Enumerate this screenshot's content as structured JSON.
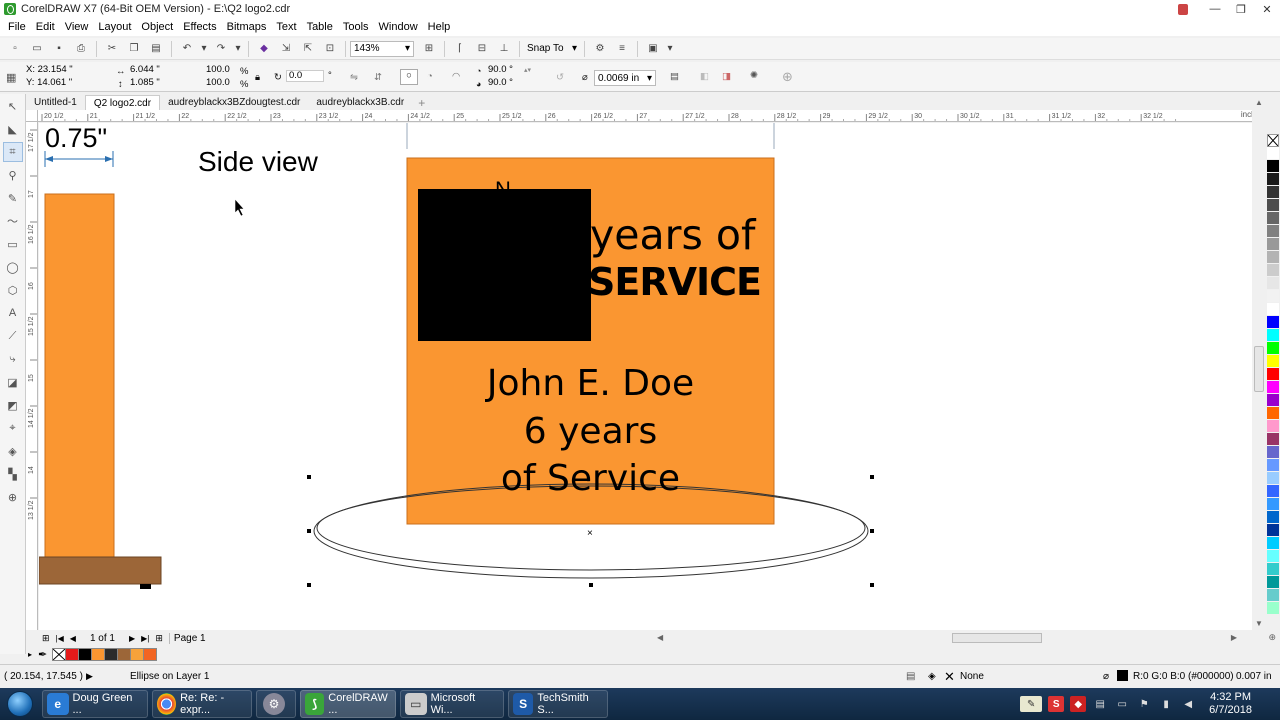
{
  "window": {
    "title": "CorelDRAW X7 (64-Bit OEM Version) - E:\\Q2 logo2.cdr",
    "minimize": "—",
    "maximize": "❐",
    "close": "✕"
  },
  "menu": [
    "File",
    "Edit",
    "View",
    "Layout",
    "Object",
    "Effects",
    "Bitmaps",
    "Text",
    "Table",
    "Tools",
    "Window",
    "Help"
  ],
  "toolbar": {
    "zoom": "143%",
    "snap_to": "Snap To"
  },
  "properties": {
    "x": "X: 23.154 \"",
    "y": "Y: 14.061 \"",
    "width": "6.044 \"",
    "height": "1.085 \"",
    "scale_w": "100.0",
    "scale_h": "100.0",
    "pct": "%",
    "rotation": "0.0",
    "deg": "°",
    "start_angle": "90.0 °",
    "end_angle": "90.0 °",
    "outline_width": "0.0069 in"
  },
  "doc_tabs": [
    "Untitled-1",
    "Q2 logo2.cdr",
    "audreyblackx3BZdougtest.cdr",
    "audreyblackx3B.cdr"
  ],
  "ruler": {
    "h_labels": [
      "20 1/2",
      "21",
      "21 1/2",
      "22",
      "22 1/2",
      "23",
      "23 1/2",
      "24",
      "24 1/2",
      "25",
      "25 1/2",
      "26",
      "26 1/2",
      "27",
      "27 1/2",
      "28",
      "28 1/2",
      "29",
      "29 1/2",
      "30",
      "30 1/2",
      "31",
      "31 1/2",
      "32",
      "32 1/2"
    ],
    "units": "inches",
    "v_labels": [
      "17 1/2",
      "17",
      "16 1/2",
      "16",
      "15 1/2",
      "15",
      "14 1/2",
      "14",
      "13 1/2"
    ]
  },
  "canvas": {
    "dimension_label": "0.75\"",
    "side_view_label": "Side view",
    "plaque": {
      "line1": "years of",
      "line2": "SERVICE",
      "name": "John E. Doe",
      "years": "6 years",
      "service": "of Service"
    }
  },
  "colors": {
    "plaque_orange": "#fa9631",
    "base_brown": "#9c6638",
    "selection_black": "#000000"
  },
  "pagebar": {
    "page_count": "1 of 1",
    "page_tab": "Page 1"
  },
  "status": {
    "coords": "( 20.154, 17.545 )",
    "selection": "Ellipse on Layer 1",
    "fill": "None",
    "outline_color": "R:0 G:0 B:0 (#000000)",
    "outline_width": "0.007 in"
  },
  "taskbar": {
    "tasks": [
      "Doug Green ...",
      "Re: Re: - expr...",
      "",
      "CorelDRAW ...",
      "Microsoft Wi...",
      "TechSmith S..."
    ],
    "time": "4:32 PM",
    "date": "6/7/2018"
  }
}
